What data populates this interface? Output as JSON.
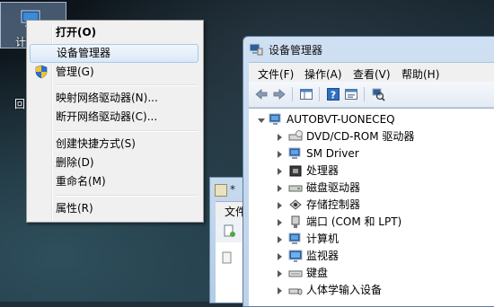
{
  "desktop": {
    "icon_label": "计",
    "icon_label_2": "回"
  },
  "context_menu": {
    "items": [
      {
        "label": "打开(O)",
        "bold": true
      },
      {
        "label": "设备管理器",
        "hover": true
      },
      {
        "label": "管理(G)",
        "icon": "shield-icon"
      },
      {
        "label": "映射网络驱动器(N)..."
      },
      {
        "label": "断开网络驱动器(C)..."
      },
      {
        "label": "创建快捷方式(S)"
      },
      {
        "label": "删除(D)"
      },
      {
        "label": "重命名(M)"
      },
      {
        "label": "属性(R)"
      }
    ]
  },
  "background_window": {
    "title": "*",
    "menu_label": "文件"
  },
  "device_manager": {
    "title": "设备管理器",
    "menu": [
      "文件(F)",
      "操作(A)",
      "查看(V)",
      "帮助(H)"
    ],
    "toolbar": [
      "back-icon",
      "forward-icon",
      "console-tree-icon",
      "help-icon",
      "properties-icon",
      "scan-hardware-icon"
    ],
    "root": "AUTOBVT-UONECEQ",
    "tree": [
      {
        "label": "DVD/CD-ROM 驱动器",
        "icon": "dvd-drive-icon"
      },
      {
        "label": "SM Driver",
        "icon": "sm-driver-icon"
      },
      {
        "label": "处理器",
        "icon": "processor-icon"
      },
      {
        "label": "磁盘驱动器",
        "icon": "disk-drive-icon"
      },
      {
        "label": "存储控制器",
        "icon": "storage-controller-icon"
      },
      {
        "label": "端口 (COM 和 LPT)",
        "icon": "port-icon"
      },
      {
        "label": "计算机",
        "icon": "computer-icon"
      },
      {
        "label": "监视器",
        "icon": "monitor-icon"
      },
      {
        "label": "键盘",
        "icon": "keyboard-icon"
      },
      {
        "label": "人体学输入设备",
        "icon": "hid-icon"
      }
    ]
  }
}
